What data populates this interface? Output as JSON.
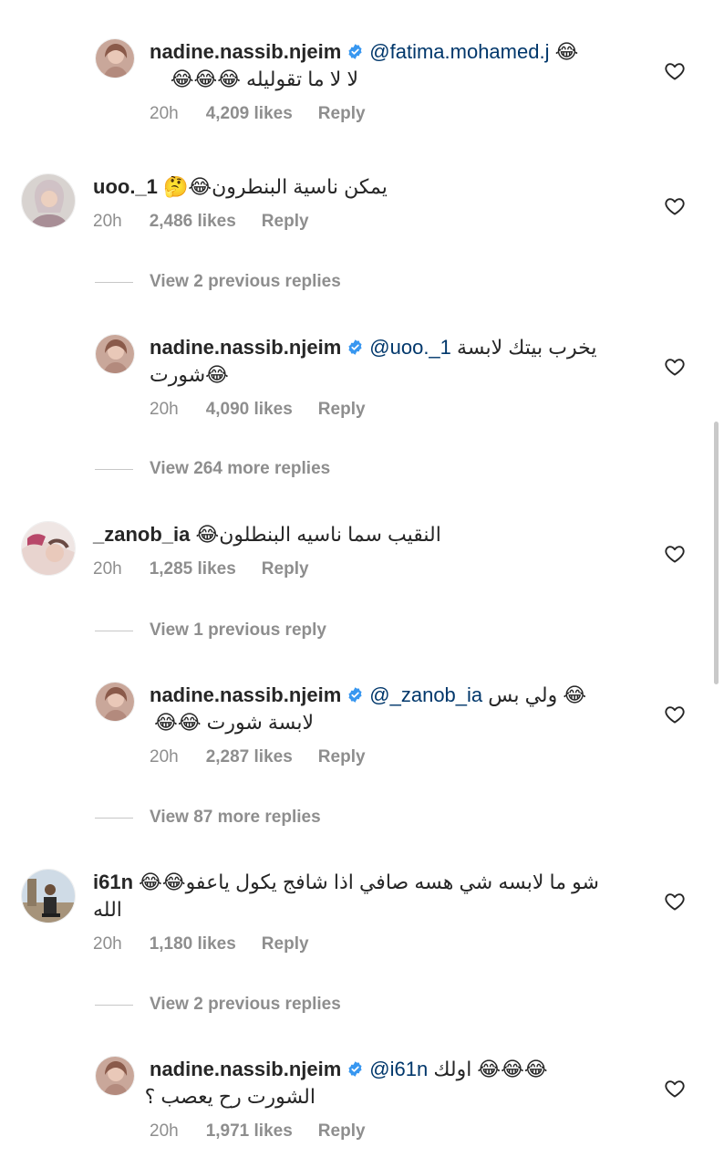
{
  "comments": [
    {
      "user": "nadine.nassib.njeim",
      "mention": "@fatima.mohamed.j",
      "line1_suffix": "😂",
      "line2": "لا لا ما تقوليله 😂😂😂",
      "time": "20h",
      "likes": "4,209 likes",
      "reply": "Reply"
    },
    {
      "user": "uoo._1",
      "text": "يمكن ناسية البنطرون😂🤔",
      "time": "20h",
      "likes": "2,486 likes",
      "reply": "Reply"
    },
    {
      "view_replies": "View 2 previous replies"
    },
    {
      "user": "nadine.nassib.njeim",
      "mention": "@uoo._1",
      "line1_suffix": "يخرب بيتك لابسة",
      "line2": "شورت😂",
      "time": "20h",
      "likes": "4,090 likes",
      "reply": "Reply"
    },
    {
      "view_replies": "View 264 more replies"
    },
    {
      "user": "_zanob_ia",
      "text": "النقيب سما ناسيه البنطلون😂",
      "time": "20h",
      "likes": "1,285 likes",
      "reply": "Reply"
    },
    {
      "view_replies": "View 1 previous reply"
    },
    {
      "user": "nadine.nassib.njeim",
      "mention": "@_zanob_ia",
      "line1_suffix": "😂 ولي بس",
      "line2": "لابسة شورت 😂😂",
      "time": "20h",
      "likes": "2,287 likes",
      "reply": "Reply"
    },
    {
      "view_replies": "View 87 more replies"
    },
    {
      "user": "i61n",
      "text": "شو ما لابسه شي هسه صافي اذا شافج يكول ياعفو😂😂",
      "line2": "الله",
      "time": "20h",
      "likes": "1,180 likes",
      "reply": "Reply"
    },
    {
      "view_replies": "View 2 previous replies"
    },
    {
      "user": "nadine.nassib.njeim",
      "mention": "@i61n",
      "line1_suffix": "😂😂😂 اولك",
      "line2": "الشورت رح يعصب ؟",
      "time": "20h",
      "likes": "1,971 likes",
      "reply": "Reply"
    }
  ],
  "colors": {
    "text": "#262626",
    "meta": "#8e8e8e",
    "mention": "#00376b",
    "verified": "#3897f0"
  },
  "icons": {
    "like": "heart-outline-icon",
    "verified": "verified-badge-icon"
  }
}
